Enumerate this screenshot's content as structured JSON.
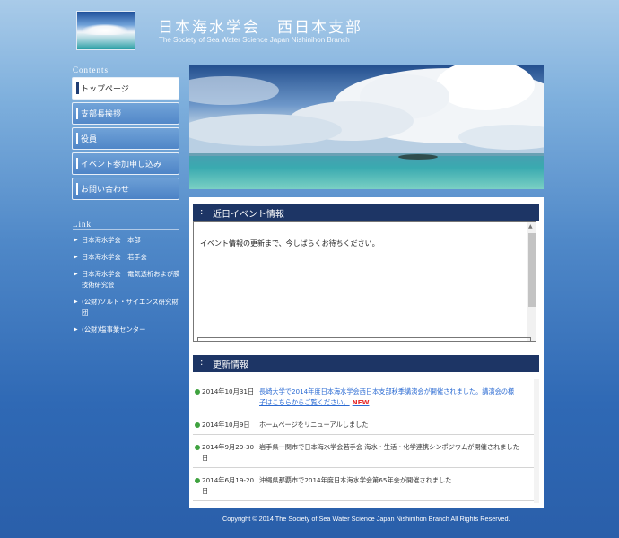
{
  "header": {
    "title": "日本海水学会　西日本支部",
    "subtitle": "The Society of Sea Water Science Japan Nishinihon Branch"
  },
  "sidebar": {
    "contents_label": "Contents",
    "nav": [
      {
        "label": "トップページ",
        "active": true
      },
      {
        "label": "支部長挨拶",
        "active": false
      },
      {
        "label": "役員",
        "active": false
      },
      {
        "label": "イベント参加申し込み",
        "active": false
      },
      {
        "label": "お問い合わせ",
        "active": false
      }
    ],
    "link_label": "Link",
    "links": [
      "日本海水学会　本部",
      "日本海水学会　若手会",
      "日本海水学会　電気透析および膜技術研究会",
      "(公財)ソルト・サイエンス研究財団",
      "(公財)塩事業センター"
    ]
  },
  "events": {
    "heading": "近日イベント情報",
    "message": "イベント情報の更新まで、今しばらくお待ちください。"
  },
  "news": {
    "heading": "更新情報",
    "items": [
      {
        "date": "2014年10月31日",
        "text": "長崎大学で2014年度日本海水学会西日本支部秋季講演会が開催されました。講演会の様子はこちらからご覧ください。",
        "new_label": "NEW",
        "linked": true
      },
      {
        "date": "2014年10月9日",
        "text": "ホームページをリニューアルしました",
        "new_label": "",
        "linked": false
      },
      {
        "date": "2014年9月29-30日",
        "text": "岩手県一関市で日本海水学会若手会 海水・生活・化学連携シンポジウムが開催されました",
        "new_label": "",
        "linked": false
      },
      {
        "date": "2014年6月19-20日",
        "text": "沖縄県那覇市で2014年度日本海水学会第65年会が開催されました",
        "new_label": "",
        "linked": false
      }
    ]
  },
  "footer": {
    "copyright": "Copyright © 2014 The Society of Sea Water Science Japan Nishinihon Branch All Rights Reserved."
  },
  "icons": {
    "nav_arrow": "triangle-right-icon",
    "news_bullet": "green-dot-icon"
  },
  "colors": {
    "heading_bar": "#1d3565",
    "link_blue": "#2b6bd3",
    "new_red": "#e62d2d",
    "bullet_green": "#3fa23f"
  }
}
